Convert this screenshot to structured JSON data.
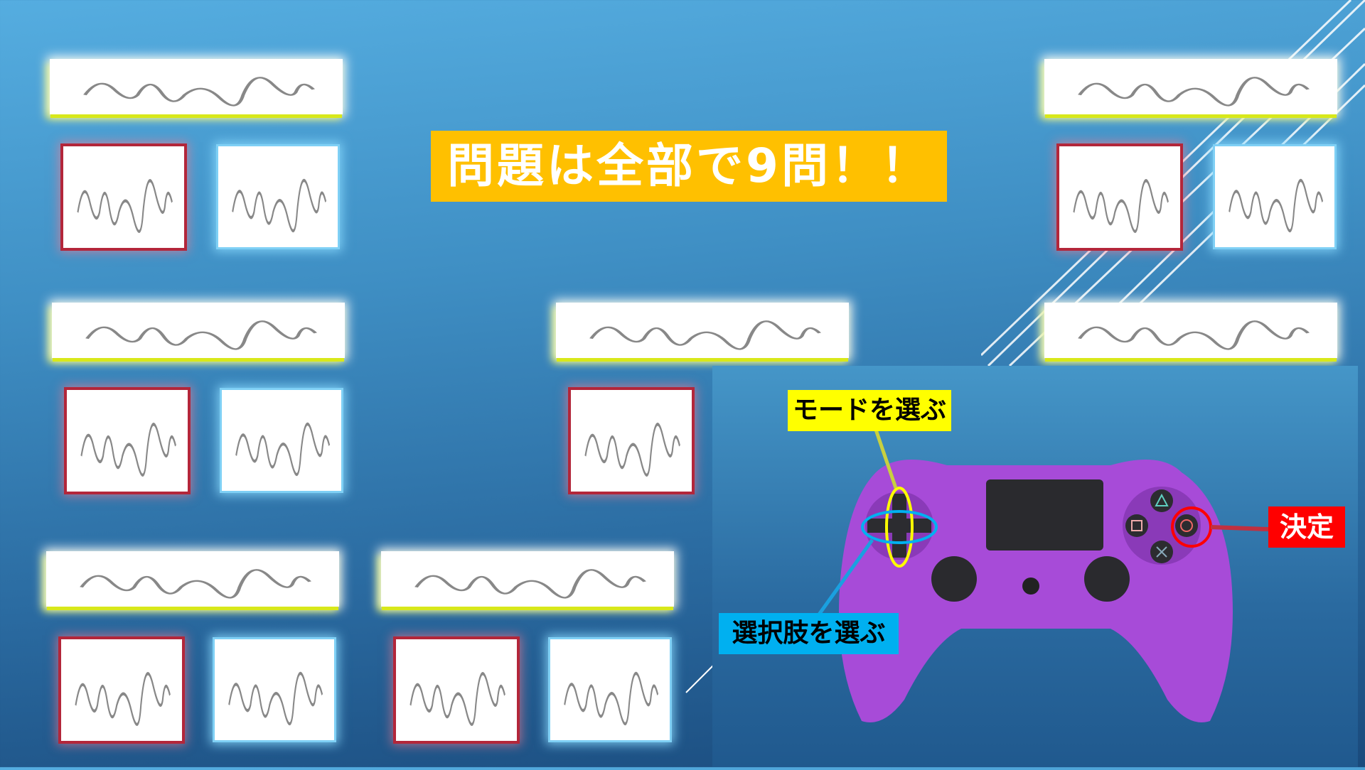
{
  "title": "問題は全部で9問！！",
  "labels": {
    "mode": "モードを選ぶ",
    "choice": "選択肢を選ぶ",
    "confirm": "決定"
  },
  "colors": {
    "title_bg": "#ffc000",
    "mode_bg": "#ffff00",
    "choice_bg": "#00b0f0",
    "confirm_bg": "#ff0000",
    "controller": "#a74bd8"
  },
  "question_count": 9
}
